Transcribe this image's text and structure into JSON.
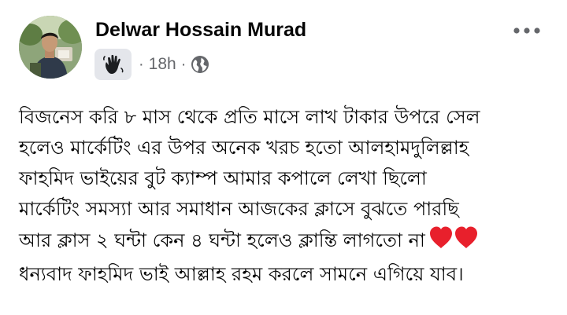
{
  "post": {
    "author": "Delwar Hossain Murad",
    "timestamp": "18h",
    "separator": "·",
    "wave_badge_icon": "waving-hand-icon",
    "privacy_icon": "globe-icon",
    "more_icon": "more-horizontal-icon",
    "body_lines": [
      "বিজনেস করি ৮ মাস থেকে প্রতি মাসে  লাখ টাকার উপরে সেল",
      "হলেও মার্কেটিং এর উপর অনেক খরচ হতো আলহামদুলিল্লাহ",
      "ফাহমিদ ভাইয়ের বুট ক্যাম্প আমার কপালে লেখা ছিলো",
      "মার্কেটিং সমস্যা আর সমাধান আজকের ক্লাসে বুঝতে পারছি",
      "আর ক্লাস ২ ঘন্টা কেন ৪ ঘন্টা হলেও ক্লান্তি লাগতো না",
      "ধন্যবাদ ফাহমিদ ভাই আল্লাহ রহম করলে সামনে এগিয়ে যাব।"
    ],
    "emoji": [
      "red-heart-icon",
      "red-heart-icon"
    ],
    "colors": {
      "text": "#050505",
      "secondary_text": "#65676b",
      "badge_background": "#e4e6eb",
      "heart": "#e8202c"
    }
  }
}
